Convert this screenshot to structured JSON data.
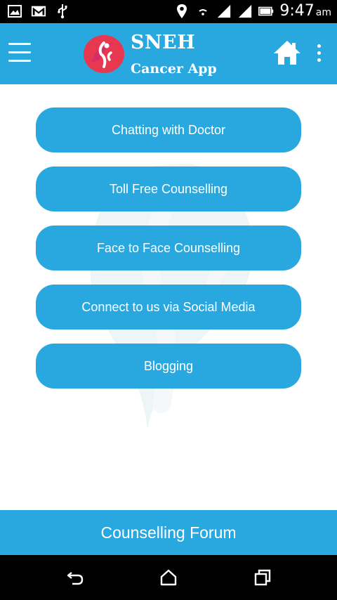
{
  "status_bar": {
    "time": "9:47",
    "ampm": "am",
    "icons": [
      "image-icon",
      "gmail-icon",
      "usb-icon",
      "location-pin-icon",
      "wifi-icon",
      "signal-icon",
      "signal-icon",
      "battery-icon"
    ]
  },
  "app_bar": {
    "title": "SNEH",
    "subtitle": "Cancer App",
    "menu_icon": "hamburger-icon",
    "home_icon": "home-icon",
    "more_icon": "more-vert-icon"
  },
  "menu": {
    "items": [
      {
        "label": "Chatting with Doctor"
      },
      {
        "label": "Toll Free Counselling"
      },
      {
        "label": "Face to Face Counselling"
      },
      {
        "label": "Connect to us via Social Media"
      },
      {
        "label": "Blogging"
      }
    ]
  },
  "footer": {
    "label": "Counselling Forum"
  },
  "nav_bar": {
    "icons": [
      "back-icon",
      "home-icon",
      "recents-icon"
    ]
  },
  "colors": {
    "primary": "#29a8e0",
    "background": "#ffffff",
    "logo_red": "#e8384f",
    "logo_pink": "#d12a6e"
  }
}
